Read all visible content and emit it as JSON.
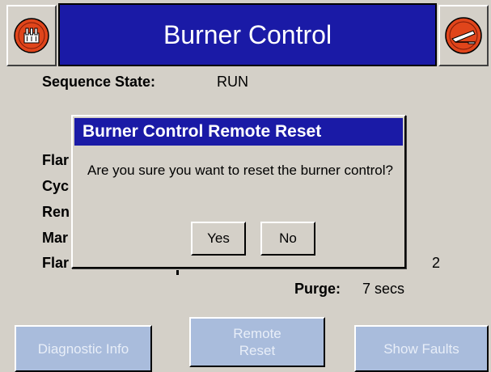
{
  "header": {
    "title": "Burner Control",
    "left_icon": "burner-icon",
    "right_icon": "flame-exit-icon"
  },
  "status": {
    "sequence_state_label": "Sequence State:",
    "sequence_state_value": "RUN",
    "row_labels_partial": [
      "Flar",
      "Cyc",
      "Ren",
      "Mar",
      "Flar"
    ],
    "trailing_digit": "2",
    "purge_label": "Purge:",
    "purge_value": "7 secs"
  },
  "dialog": {
    "title": "Burner Control Remote Reset",
    "message": "Are you sure you want to reset the burner control?",
    "yes_label": "Yes",
    "no_label": "No"
  },
  "footer": {
    "diagnostic_label": "Diagnostic Info",
    "remote_reset_line1": "Remote",
    "remote_reset_line2": "Reset",
    "show_faults_label": "Show Faults"
  },
  "colors": {
    "title_blue": "#1a1aa6",
    "background": "#d4d0c8",
    "disabled_button": "#a9bcdc",
    "icon_red": "#e0451b"
  }
}
